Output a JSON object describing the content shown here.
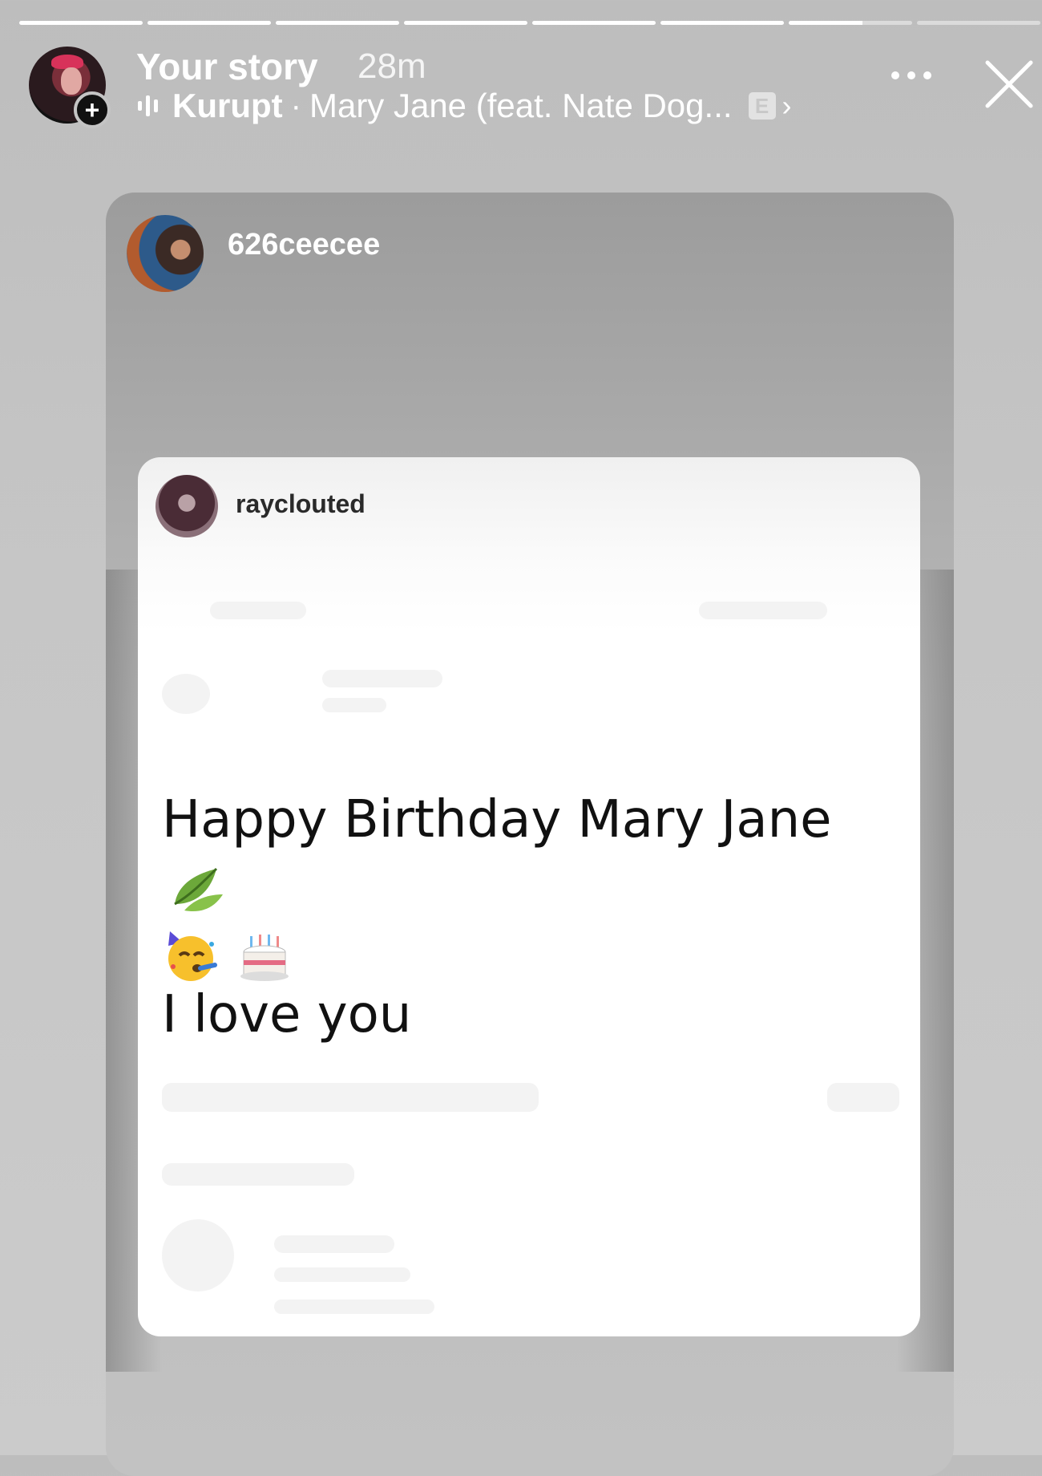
{
  "story": {
    "progress_segments": [
      1,
      1,
      1,
      1,
      1,
      1,
      0.6,
      0
    ],
    "title": "Your story",
    "time": "28m",
    "music": {
      "artist": "Kurupt",
      "separator": "·",
      "song": "Mary Jane (feat. Nate Dog...",
      "explicit_badge": "E"
    },
    "add_badge": "+"
  },
  "repost": {
    "username": "626ceecee",
    "post": {
      "username": "rayclouted",
      "message_line1": "Happy Birthday Mary Jane",
      "message_line2": "I love you",
      "emojis": [
        "leaf-icon",
        "partying-face-icon",
        "birthday-cake-icon"
      ]
    }
  },
  "colors": {
    "background": "#c4c4c4",
    "text": "#ffffff"
  }
}
